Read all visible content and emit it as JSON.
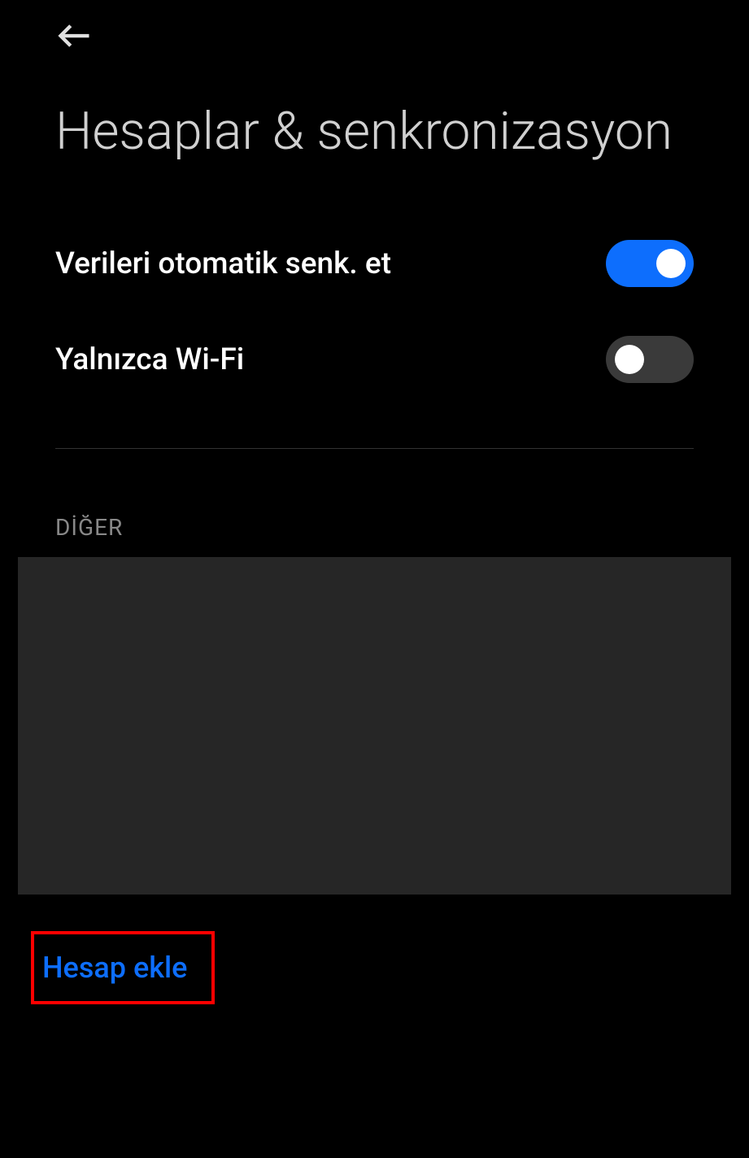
{
  "header": {
    "back_icon": "arrow-left"
  },
  "page_title": "Hesaplar & senkronizasyon",
  "settings": {
    "auto_sync": {
      "label": "Verileri otomatik senk. et",
      "enabled": true
    },
    "wifi_only": {
      "label": "Yalnızca Wi-Fi",
      "enabled": false
    }
  },
  "sections": {
    "other": {
      "header": "DİĞER"
    }
  },
  "actions": {
    "add_account_label": "Hesap ekle"
  }
}
